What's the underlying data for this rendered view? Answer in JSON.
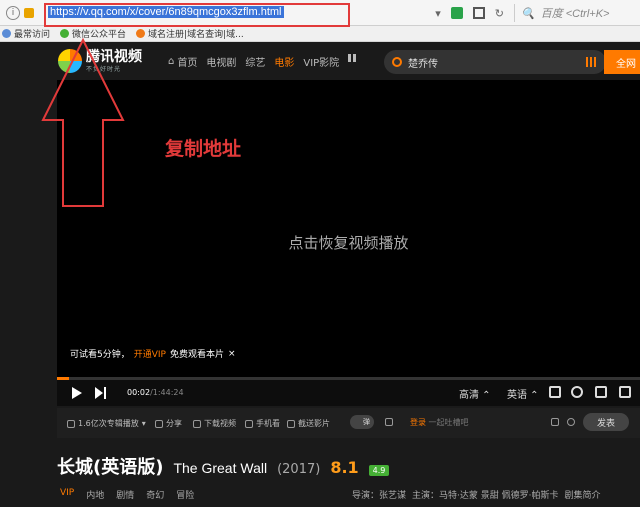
{
  "browser": {
    "url": "https://v.qq.com/x/cover/6n89qmcgox3zflm.html",
    "search_placeholder": "百度 <Ctrl+K>",
    "bookmarks": [
      "最常访问",
      "微信公众平台",
      "域名注册|域名查询|域..."
    ]
  },
  "annotation": {
    "label": "复制地址",
    "color": "#e23a3a"
  },
  "site": {
    "logo_name": "腾讯视频",
    "logo_slogan": "不负好时光",
    "nav": {
      "home": "首页",
      "tv": "电视剧",
      "variety": "综艺",
      "movie": "电影",
      "vip": "VIP影院"
    },
    "search_value": "楚乔传",
    "fullnet_label": "全网"
  },
  "player": {
    "resume_text": "点击恢复视频播放",
    "trial_text": "可试看5分钟，",
    "trial_link": "开通VIP",
    "trial_suffix": "免费观看本片",
    "trial_close": "×",
    "time_current": "00:02",
    "time_total": "/1:44:24",
    "progress": 0.02,
    "quality": "高清",
    "language": "英语",
    "accent": "#ff7a00"
  },
  "actions": {
    "playlist": "1.6亿次专辑播放",
    "share": "分享",
    "download": "下载视频",
    "phone": "手机看",
    "clip": "截送影片",
    "danmu": "弹",
    "login": "登录",
    "login_hint": "一起吐槽吧",
    "send": "发表"
  },
  "movie": {
    "title_cn": "长城(英语版)",
    "title_en": "The Great Wall",
    "year": "(2017)",
    "score": "8.1",
    "badge": "4.9",
    "tags": [
      "VIP",
      "内地",
      "剧情",
      "奇幻",
      "冒险"
    ],
    "director": "导演：张艺谋",
    "cast": "主演：马特·达蒙 景甜 佩德罗·帕斯卡",
    "intro": "剧集简介"
  }
}
